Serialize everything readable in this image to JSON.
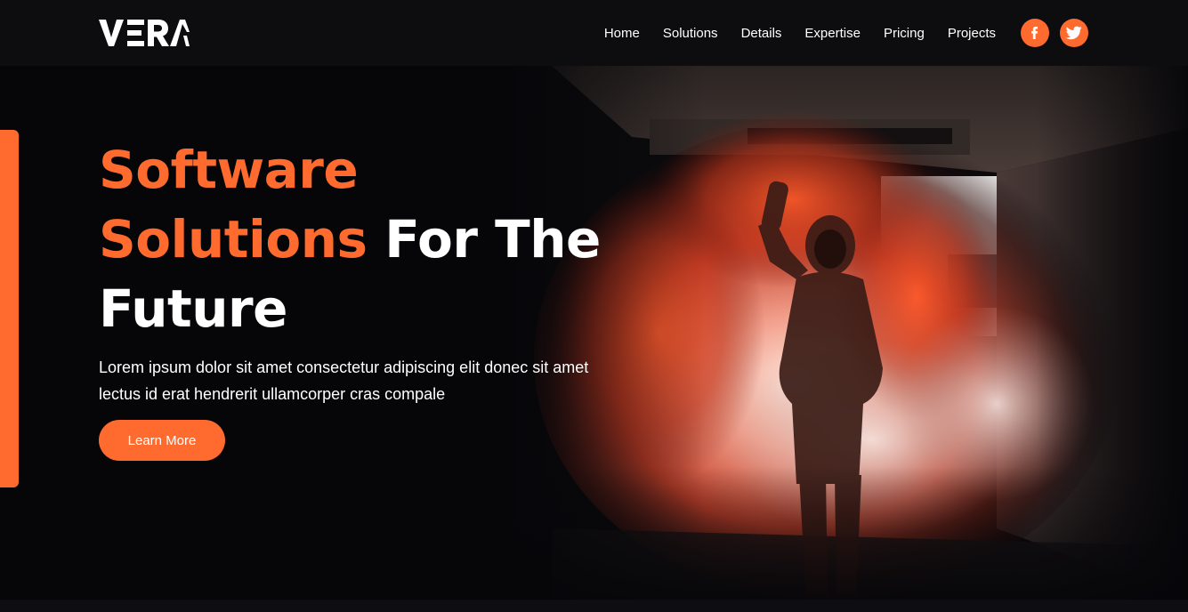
{
  "brand": {
    "name": "VERA",
    "accent_color": "#ff6b2e",
    "background_color": "#07070a"
  },
  "nav": {
    "items": [
      {
        "label": "Home"
      },
      {
        "label": "Solutions"
      },
      {
        "label": "Details"
      },
      {
        "label": "Expertise"
      },
      {
        "label": "Pricing"
      },
      {
        "label": "Projects"
      }
    ],
    "social": [
      {
        "icon": "facebook-icon"
      },
      {
        "icon": "twitter-icon"
      }
    ]
  },
  "hero": {
    "title_highlight_1": "Software",
    "title_highlight_2": "Solutions",
    "title_rest_1": " For The",
    "title_rest_2": "Future",
    "description": "Lorem ipsum dolor sit amet consectetur adipiscing elit donec sit amet lectus id erat hendrerit ullamcorper cras compale",
    "cta_label": "Learn More",
    "image": "person-with-orange-smoke-flare-in-tunnel"
  }
}
